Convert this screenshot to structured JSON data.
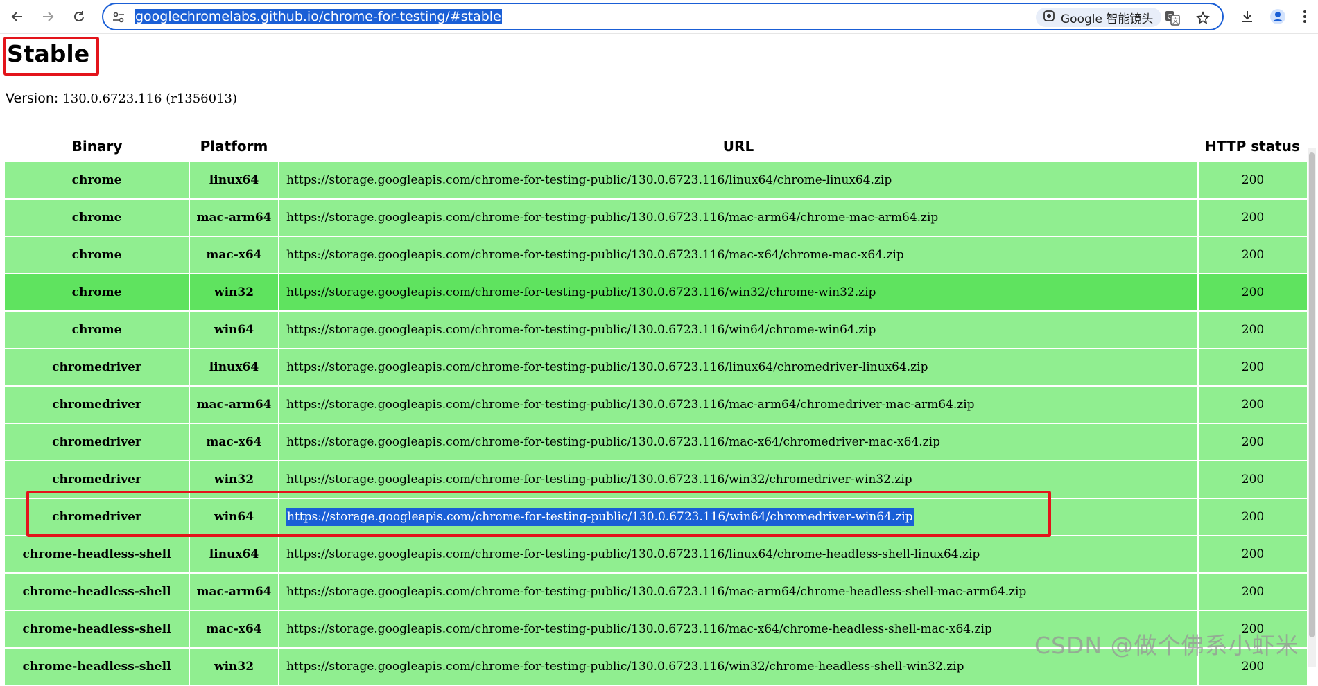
{
  "browser": {
    "url": "googlechromelabs.github.io/chrome-for-testing/#stable",
    "lens_label": "Google 智能镜头"
  },
  "page": {
    "title": "Stable",
    "version_label": "Version:",
    "version_value": "130.0.6723.116 (r1356013)"
  },
  "table": {
    "headers": [
      "Binary",
      "Platform",
      "URL",
      "HTTP status"
    ],
    "rows": [
      {
        "binary": "chrome",
        "platform": "linux64",
        "url": "https://storage.googleapis.com/chrome-for-testing-public/130.0.6723.116/linux64/chrome-linux64.zip",
        "status": "200"
      },
      {
        "binary": "chrome",
        "platform": "mac-arm64",
        "url": "https://storage.googleapis.com/chrome-for-testing-public/130.0.6723.116/mac-arm64/chrome-mac-arm64.zip",
        "status": "200"
      },
      {
        "binary": "chrome",
        "platform": "mac-x64",
        "url": "https://storage.googleapis.com/chrome-for-testing-public/130.0.6723.116/mac-x64/chrome-mac-x64.zip",
        "status": "200"
      },
      {
        "binary": "chrome",
        "platform": "win32",
        "url": "https://storage.googleapis.com/chrome-for-testing-public/130.0.6723.116/win32/chrome-win32.zip",
        "status": "200"
      },
      {
        "binary": "chrome",
        "platform": "win64",
        "url": "https://storage.googleapis.com/chrome-for-testing-public/130.0.6723.116/win64/chrome-win64.zip",
        "status": "200"
      },
      {
        "binary": "chromedriver",
        "platform": "linux64",
        "url": "https://storage.googleapis.com/chrome-for-testing-public/130.0.6723.116/linux64/chromedriver-linux64.zip",
        "status": "200"
      },
      {
        "binary": "chromedriver",
        "platform": "mac-arm64",
        "url": "https://storage.googleapis.com/chrome-for-testing-public/130.0.6723.116/mac-arm64/chromedriver-mac-arm64.zip",
        "status": "200"
      },
      {
        "binary": "chromedriver",
        "platform": "mac-x64",
        "url": "https://storage.googleapis.com/chrome-for-testing-public/130.0.6723.116/mac-x64/chromedriver-mac-x64.zip",
        "status": "200"
      },
      {
        "binary": "chromedriver",
        "platform": "win32",
        "url": "https://storage.googleapis.com/chrome-for-testing-public/130.0.6723.116/win32/chromedriver-win32.zip",
        "status": "200"
      },
      {
        "binary": "chromedriver",
        "platform": "win64",
        "url": "https://storage.googleapis.com/chrome-for-testing-public/130.0.6723.116/win64/chromedriver-win64.zip",
        "status": "200"
      },
      {
        "binary": "chrome-headless-shell",
        "platform": "linux64",
        "url": "https://storage.googleapis.com/chrome-for-testing-public/130.0.6723.116/linux64/chrome-headless-shell-linux64.zip",
        "status": "200"
      },
      {
        "binary": "chrome-headless-shell",
        "platform": "mac-arm64",
        "url": "https://storage.googleapis.com/chrome-for-testing-public/130.0.6723.116/mac-arm64/chrome-headless-shell-mac-arm64.zip",
        "status": "200"
      },
      {
        "binary": "chrome-headless-shell",
        "platform": "mac-x64",
        "url": "https://storage.googleapis.com/chrome-for-testing-public/130.0.6723.116/mac-x64/chrome-headless-shell-mac-x64.zip",
        "status": "200"
      },
      {
        "binary": "chrome-headless-shell",
        "platform": "win32",
        "url": "https://storage.googleapis.com/chrome-for-testing-public/130.0.6723.116/win32/chrome-headless-shell-win32.zip",
        "status": "200"
      }
    ]
  },
  "watermark": "CSDN @做个佛系小虾米",
  "colors": {
    "row_bg": "#90ee90",
    "row_hover_bg": "#5fe35f",
    "selection": "#1a5fd6",
    "annotation_red": "#e3141b"
  }
}
